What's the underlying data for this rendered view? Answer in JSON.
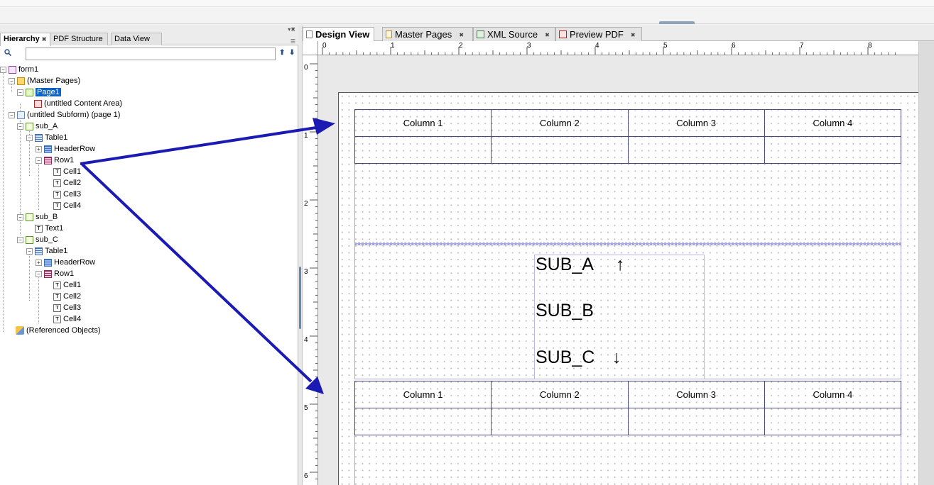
{
  "left_panel": {
    "tabs": [
      {
        "label": "Hierarchy",
        "active": true
      },
      {
        "label": "PDF Structure",
        "active": false
      },
      {
        "label": "Data View",
        "active": false
      }
    ],
    "search": {
      "value": "",
      "placeholder": ""
    }
  },
  "tree": {
    "form": "form1",
    "master_pages": "(Master Pages)",
    "page1": "Page1",
    "content_area": "(untitled Content Area)",
    "subform": "(untitled Subform) (page 1)",
    "sub_a": "sub_A",
    "sub_a_table": "Table1",
    "sub_a_header": "HeaderRow",
    "sub_a_row": "Row1",
    "sub_a_cells": [
      "Cell1",
      "Cell2",
      "Cell3",
      "Cell4"
    ],
    "sub_b": "sub_B",
    "sub_b_text": "Text1",
    "sub_c": "sub_C",
    "sub_c_table": "Table1",
    "sub_c_header": "HeaderRow",
    "sub_c_row": "Row1",
    "sub_c_cells": [
      "Cell1",
      "Cell2",
      "Cell3",
      "Cell4"
    ],
    "referenced": "(Referenced Objects)"
  },
  "right_tabs": [
    {
      "label": "Design View",
      "active": true
    },
    {
      "label": "Master Pages",
      "active": false
    },
    {
      "label": "XML Source",
      "active": false
    },
    {
      "label": "Preview PDF",
      "active": false
    }
  ],
  "ruler": {
    "top_marks": [
      "0",
      "1",
      "2",
      "3",
      "4",
      "5",
      "6",
      "7",
      "8"
    ],
    "left_marks": [
      "0",
      "1",
      "2",
      "3",
      "4",
      "5",
      "6"
    ]
  },
  "design": {
    "table_a_headers": [
      "Column 1",
      "Column 2",
      "Column 3",
      "Column 4"
    ],
    "table_c_headers": [
      "Column 1",
      "Column 2",
      "Column 3",
      "Column 4"
    ],
    "sub_labels": {
      "a": "SUB_A",
      "b": "SUB_B",
      "c": "SUB_C"
    },
    "arrow_up": "↑",
    "arrow_down": "↓"
  },
  "colors": {
    "annotation_arrow": "#1b1bb4",
    "selection": "#0b63c7"
  }
}
